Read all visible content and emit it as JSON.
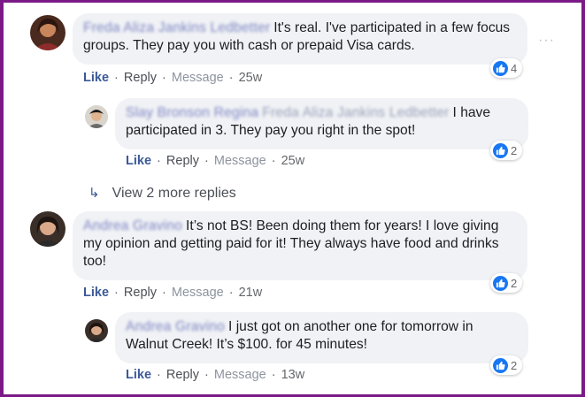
{
  "comments": [
    {
      "author": "Freda Aliza Jankins Ledbetter",
      "text": "It's real. I've participated in a few focus groups. They pay you with cash or prepaid Visa cards.",
      "actions": {
        "like": "Like",
        "reply": "Reply",
        "message": "Message",
        "time": "25w"
      },
      "reactions": "4"
    },
    {
      "author": "Slay Bronson Regina",
      "mention": "Freda Aliza Jankins Ledbetter",
      "text": "I have participated in 3. They pay you right in the spot!",
      "actions": {
        "like": "Like",
        "reply": "Reply",
        "message": "Message",
        "time": "25w"
      },
      "reactions": "2"
    },
    {
      "author": "Andrea Gravino",
      "text": "It’s not BS! Been doing them for years! I love giving my opinion and getting paid for it! They always have food and drinks too!",
      "actions": {
        "like": "Like",
        "reply": "Reply",
        "message": "Message",
        "time": "21w"
      },
      "reactions": "2"
    },
    {
      "author": "Andrea Gravino",
      "text": "I just got on another one for tomorrow in Walnut Creek! It’s $100. for 45 minutes!",
      "actions": {
        "like": "Like",
        "reply": "Reply",
        "message": "Message",
        "time": "13w"
      },
      "reactions": "2"
    }
  ],
  "view_more": "View 2 more replies",
  "more_options": "···",
  "colors": {
    "frame": "#7b1a86",
    "like": "#3b5998",
    "bubble": "#f0f2f5",
    "reaction": "#1877f2"
  }
}
